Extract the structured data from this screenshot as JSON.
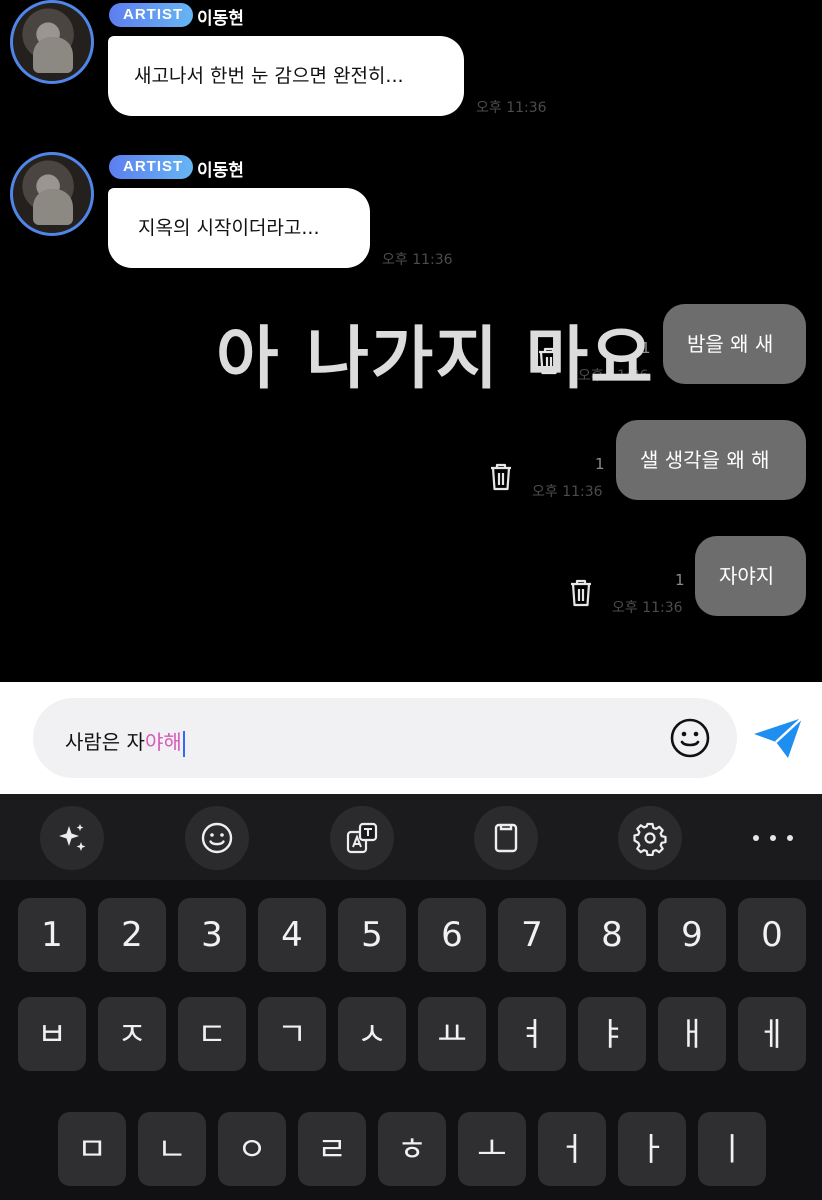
{
  "messages_in": [
    {
      "badge": "ARTIST",
      "author": "이동현",
      "text": "새고나서 한번 눈 감으면 완전히...",
      "time": "오후 11:36"
    },
    {
      "badge": "ARTIST",
      "author": "이동현",
      "text": "지옥의 시작이더라고...",
      "time": "오후 11:36"
    }
  ],
  "messages_out": [
    {
      "text": "밤을 왜 새",
      "read": "1",
      "time": "오후 11:36"
    },
    {
      "text": "샐 생각을 왜 해",
      "read": "1",
      "time": "오후 11:36"
    },
    {
      "text": "자야지",
      "read": "1",
      "time": "오후 11:36"
    }
  ],
  "overlay_caption": "아 나가지 마요",
  "composer": {
    "committed": "사람은 자",
    "composing": "야해"
  },
  "keyboard": {
    "row_numbers": [
      "1",
      "2",
      "3",
      "4",
      "5",
      "6",
      "7",
      "8",
      "9",
      "0"
    ],
    "row_2": [
      "ㅂ",
      "ㅈ",
      "ㄷ",
      "ㄱ",
      "ㅅ",
      "ㅛ",
      "ㅕ",
      "ㅑ",
      "ㅐ",
      "ㅔ"
    ],
    "row_3": [
      "ㅁ",
      "ㄴ",
      "ㅇ",
      "ㄹ",
      "ㅎ",
      "ㅗ",
      "ㅓ",
      "ㅏ",
      "ㅣ"
    ]
  },
  "toolbar_icons": [
    "sparkle-icon",
    "emoji-icon",
    "translate-icon",
    "clipboard-icon",
    "settings-icon",
    "more-icon"
  ],
  "colors": {
    "incoming_bubble": "#ffffff",
    "outgoing_bubble": "#6d6d6d",
    "badge_gradient": [
      "#5d7ef0",
      "#66b6f3"
    ],
    "send": "#1e8ef0"
  }
}
